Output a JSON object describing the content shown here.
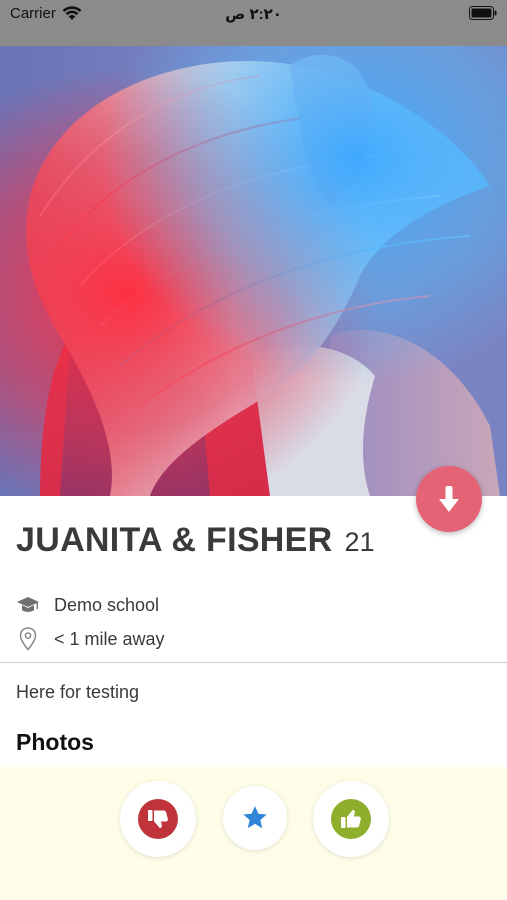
{
  "status_bar": {
    "carrier": "Carrier",
    "time": "٢:٢٠ ص",
    "wifi_icon": "wifi-icon",
    "battery_icon": "battery-icon"
  },
  "profile": {
    "photo": "profile-photo",
    "name": "JUANITA & FISHER",
    "age": "21",
    "school": "Demo school",
    "distance": "< 1 mile away",
    "bio": "Here for testing"
  },
  "sections": {
    "photos_heading": "Photos"
  },
  "actions": {
    "download_icon": "arrow-down-icon",
    "dislike_icon": "thumbs-down-icon",
    "superlike_icon": "star-icon",
    "like_icon": "thumbs-up-icon"
  },
  "colors": {
    "download_button": "#e46375",
    "dislike": "#c0333a",
    "star": "#2f86d9",
    "like": "#8fae2b",
    "action_bar_bg": "#fdfde8"
  }
}
